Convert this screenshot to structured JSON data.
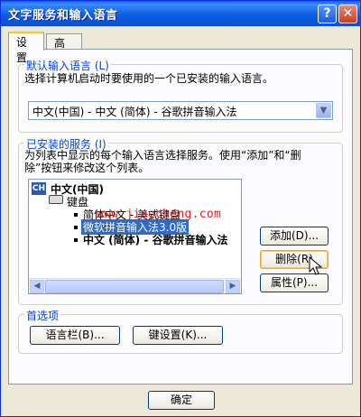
{
  "window": {
    "title": "文字服务和输入语言"
  },
  "titlebar": {
    "help_label": "?",
    "close_label": "✕"
  },
  "tabs": [
    {
      "label": "设置"
    },
    {
      "label": "高级"
    }
  ],
  "default_language": {
    "legend": "默认输入语言 (L)",
    "description": "选择计算机启动时要使用的一个已安装的输入语言。",
    "selected": "中文(中国) - 中文 (简体) - 谷歌拼音输入法"
  },
  "installed_services": {
    "legend": "已安装的服务 (I)",
    "description_line1": "为列表中显示的每个输入语言选择服务。使用“添加”和“删",
    "description_line2": "除”按钮来修改这个列表。",
    "tree": {
      "language_icon": "CH",
      "language": "中文(中国)",
      "category": "键盘",
      "items": [
        "简体中文 - 美式键盘",
        "微软拼音输入法3.0版",
        "中文 (简体) - 谷歌拼音输入法"
      ]
    },
    "add_label": "添加(D)...",
    "remove_label": "删除(R)",
    "properties_label": "属性(P)..."
  },
  "preferences": {
    "legend": "首选项",
    "language_bar_label": "语言栏(B)...",
    "key_settings_label": "键设置(K)..."
  },
  "ok_label": "确定",
  "watermark": "www.jiaocheng.com"
}
